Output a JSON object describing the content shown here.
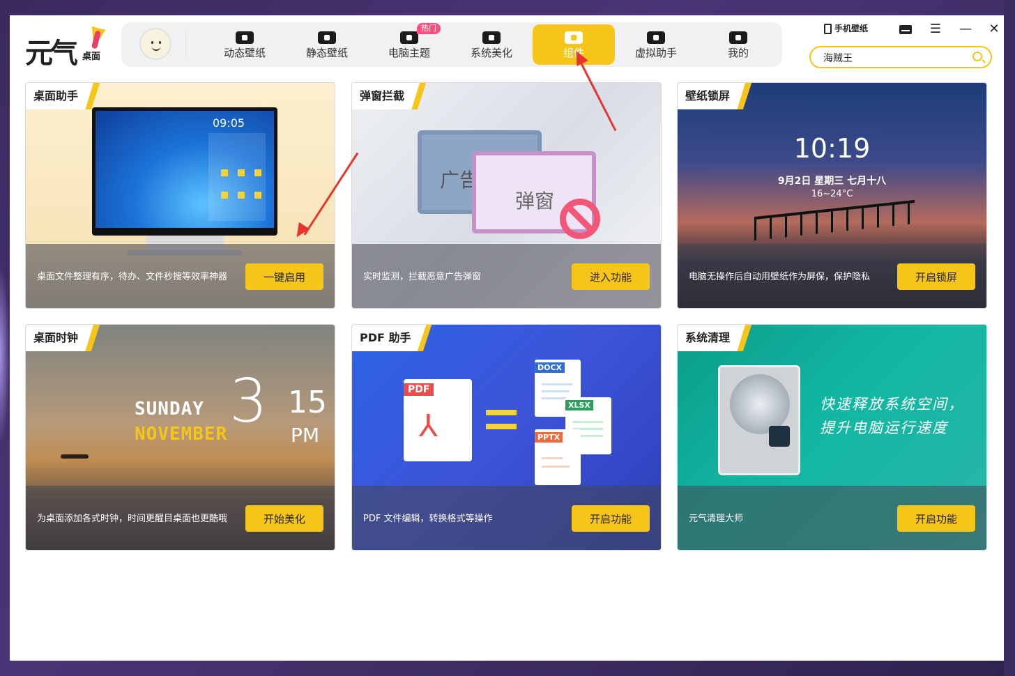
{
  "app": {
    "logo_text": "元气",
    "logo_sub": "桌面"
  },
  "nav": {
    "items": [
      {
        "label": "动态壁纸",
        "icon": "tv-icon"
      },
      {
        "label": "静态壁纸",
        "icon": "image-icon"
      },
      {
        "label": "电脑主题",
        "icon": "theme-icon"
      },
      {
        "label": "系统美化",
        "icon": "flower-icon"
      },
      {
        "label": "组件",
        "icon": "widget-icon"
      },
      {
        "label": "虚拟助手",
        "icon": "paw-icon"
      },
      {
        "label": "我的",
        "icon": "face-icon"
      }
    ],
    "active_index": 4,
    "hot_badge": "热门"
  },
  "top_right": {
    "phone_wallpaper": "手机壁纸"
  },
  "search": {
    "value": "海贼王"
  },
  "cards": [
    {
      "tag": "桌面助手",
      "desc": "桌面文件整理有序，待办、文件秒搜等效率神器",
      "action": "一键启用",
      "clock": "09:05"
    },
    {
      "tag": "弹窗拦截",
      "desc": "实时监测，拦截恶意广告弹窗",
      "action": "进入功能",
      "ad_text": "广告",
      "popup_text": "弹窗"
    },
    {
      "tag": "壁纸锁屏",
      "desc": "电脑无操作后自动用壁纸作为屏保，保护隐私",
      "action": "开启锁屏",
      "time": "10:19",
      "date": "9月2日 星期三   七月十八",
      "weather": "16~24°C"
    },
    {
      "tag": "桌面时钟",
      "desc": "为桌面添加各式时钟，时间更醒目桌面也更酷哦",
      "action": "开始美化",
      "day": "SUNDAY",
      "month": "NOVEMBER",
      "hour": "3",
      "minute": "15",
      "ampm": "PM"
    },
    {
      "tag": "PDF 助手",
      "desc": "PDF 文件编辑，转换格式等操作",
      "action": "开启功能",
      "pdf_label": "PDF",
      "docx_label": "DOCX",
      "xlsx_label": "XLSX",
      "pptx_label": "PPTX"
    },
    {
      "tag": "系统清理",
      "desc": "元气清理大师",
      "action": "开启功能",
      "slogan1": "快速释放系统空间，",
      "slogan2": "提升电脑运行速度"
    }
  ],
  "colors": {
    "accent": "#f6c51a",
    "hot": "#ff4d7e",
    "annotation": "#e8332e"
  }
}
